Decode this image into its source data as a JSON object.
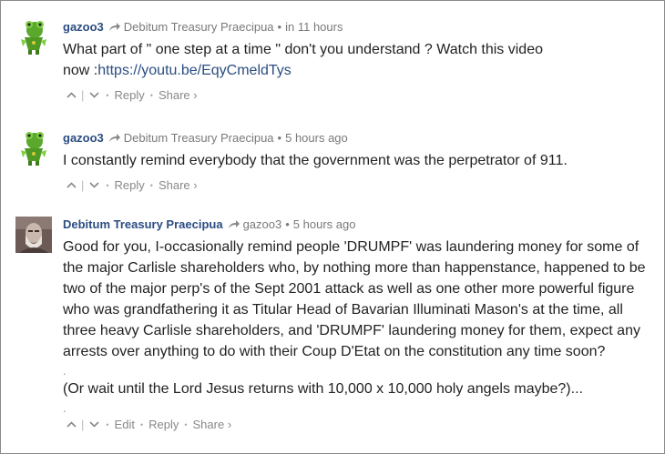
{
  "comments": [
    {
      "author": "gazoo3",
      "reply_to": "Debitum Treasury Praecipua",
      "time": "in 11 hours",
      "lines": [
        "What part of \" one step at a time \" don't you understand ? Watch this video"
      ],
      "link_prefix": "now :",
      "link_text": "https://youtu.be/EqyCmeldTys",
      "actions": {
        "reply": "Reply",
        "share": "Share ›"
      }
    },
    {
      "author": "gazoo3",
      "reply_to": "Debitum Treasury Praecipua",
      "time": "5 hours ago",
      "text": "I constantly remind everybody that the government was the perpetrator of 911.",
      "actions": {
        "reply": "Reply",
        "share": "Share ›"
      }
    },
    {
      "author": "Debitum Treasury Praecipua",
      "reply_to": "gazoo3",
      "time": "5 hours ago",
      "paragraph1": "Good for you, I-occasionally remind people 'DRUMPF' was laundering money for some of the major Carlisle shareholders who, by nothing more than happenstance, happened to be two of the major perp's of the Sept 2001 attack as well as one other more powerful figure who was grandfathering it as Titular Head of Bavarian Illuminati Mason's at the time, all three heavy Carlisle shareholders, and 'DRUMPF' laundering money for them, expect any arrests over anything to do with their Coup D'Etat on the constitution any time soon?",
      "dot1": ".",
      "paragraph2": "(Or wait until the Lord Jesus returns with 10,000 x 10,000 holy angels maybe?)...",
      "dot2": ".",
      "actions": {
        "edit": "Edit",
        "reply": "Reply",
        "share": "Share ›"
      }
    }
  ],
  "icons": {
    "upvote": "chevron-up-icon",
    "downvote": "chevron-down-icon",
    "reply_arrow": "reply-arrow-icon"
  },
  "colors": {
    "author": "#2b4d82",
    "meta": "#7a7a7a",
    "frame": "#8a8a8a"
  }
}
